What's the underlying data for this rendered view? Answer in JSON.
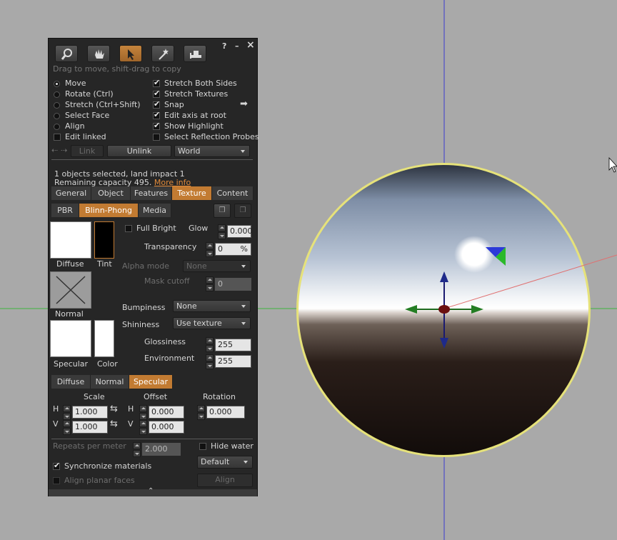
{
  "toolbar": {
    "help": "?",
    "minimize": "–",
    "close": "×",
    "hint": "Drag to move, shift-drag to copy"
  },
  "modes": [
    {
      "label": "Move",
      "selected": true
    },
    {
      "label": "Rotate (Ctrl)",
      "selected": false
    },
    {
      "label": "Stretch (Ctrl+Shift)",
      "selected": false
    },
    {
      "label": "Select Face",
      "selected": false
    },
    {
      "label": "Align",
      "selected": false
    }
  ],
  "edit_linked": "Edit linked",
  "options": [
    {
      "label": "Stretch Both Sides",
      "checked": true
    },
    {
      "label": "Stretch Textures",
      "checked": true
    },
    {
      "label": "Snap",
      "checked": true
    },
    {
      "label": "Edit axis at root",
      "checked": true
    },
    {
      "label": "Show Highlight",
      "checked": true
    },
    {
      "label": "Select Reflection Probes",
      "checked": false
    }
  ],
  "link_row": {
    "link": "Link",
    "unlink": "Unlink",
    "ruler": "World"
  },
  "selection": {
    "line1": "1 objects selected, land impact 1",
    "line2": "Remaining capacity 495.",
    "more": "More info"
  },
  "main_tabs": [
    "General",
    "Object",
    "Features",
    "Texture",
    "Content"
  ],
  "material_tabs": [
    "PBR",
    "Blinn-Phong",
    "Media"
  ],
  "texture": {
    "diffuse": "Diffuse",
    "tint": "Tint",
    "normal": "Normal",
    "specular": "Specular",
    "color": "Color",
    "full_bright": "Full Bright",
    "glow": "Glow",
    "glow_value": "0.000",
    "transparency": "Transparency",
    "transparency_value": "0",
    "percent": "%",
    "alpha_mode": "Alpha mode",
    "alpha_mode_value": "None",
    "mask_cutoff": "Mask cutoff",
    "mask_cutoff_value": "0",
    "bumpiness": "Bumpiness",
    "bumpiness_value": "None",
    "shininess": "Shininess",
    "shininess_value": "Use texture",
    "glossiness": "Glossiness",
    "glossiness_value": "255",
    "environment": "Environment",
    "environment_value": "255"
  },
  "map_tabs": [
    "Diffuse",
    "Normal",
    "Specular"
  ],
  "mapping": {
    "scale": "Scale",
    "offset": "Offset",
    "rotation": "Rotation",
    "h": "H",
    "v": "V",
    "scale_h": "1.000",
    "scale_v": "1.000",
    "offset_h": "0.000",
    "offset_v": "0.000",
    "rotation_value": "0.000"
  },
  "bottom": {
    "repeats": "Repeats per meter",
    "repeats_value": "2.000",
    "hide_water": "Hide water",
    "align_mode": "Default",
    "sync": "Synchronize materials",
    "align_planar": "Align planar faces",
    "align_btn": "Align"
  },
  "colors": {
    "accent": "#c27b32",
    "panel": "#262626",
    "viewport": "#a9a9a9"
  }
}
